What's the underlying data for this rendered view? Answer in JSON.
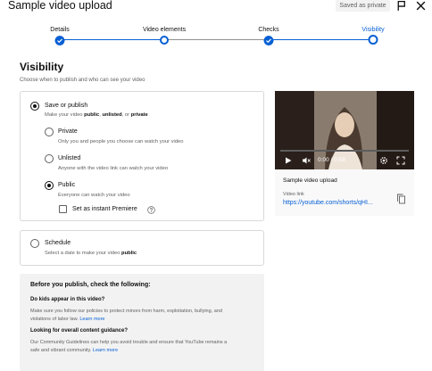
{
  "header": {
    "title": "Sample video upload",
    "saved_badge": "Saved as private",
    "icons": [
      "flag-icon",
      "close-icon"
    ]
  },
  "stepper": {
    "steps": [
      {
        "label": "Details",
        "state": "done"
      },
      {
        "label": "Video elements",
        "state": "current"
      },
      {
        "label": "Checks",
        "state": "done"
      },
      {
        "label": "Visibility",
        "state": "active"
      }
    ]
  },
  "visibility": {
    "title": "Visibility",
    "subtitle": "Choose when to publish and who can see your video",
    "save_or_publish": {
      "label": "Save or publish",
      "desc_pre": "Make your video ",
      "desc_b1": "public",
      "desc_mid1": ", ",
      "desc_b2": "unlisted",
      "desc_mid2": ", or ",
      "desc_b3": "private",
      "checked": true
    },
    "options": [
      {
        "label": "Private",
        "desc": "Only you and people you choose can watch your video",
        "checked": false
      },
      {
        "label": "Unlisted",
        "desc": "Anyone with the video link can watch your video",
        "checked": false
      },
      {
        "label": "Public",
        "desc": "Everyone can watch your video",
        "checked": true
      }
    ],
    "premiere_label": "Set as instant Premiere",
    "premiere_checked": false
  },
  "schedule": {
    "label": "Schedule",
    "desc_pre": "Select a date to make your video ",
    "desc_b": "public",
    "checked": false
  },
  "checklist": {
    "title": "Before you publish, check the following:",
    "q1": "Do kids appear in this video?",
    "p1": "Make sure you follow our policies to protect minors from harm, exploitation, bullying, and violations of labor law.",
    "p1_link": "Learn more",
    "q2": "Looking for overall content guidance?",
    "p2": "Our Community Guidelines can help you avoid trouble and ensure that YouTube remains a safe and vibrant community.",
    "p2_link": "Learn more"
  },
  "preview": {
    "time": "0:00 / 0:59",
    "title": "Sample video upload",
    "link_label": "Video link",
    "link": "https://youtube.com/shorts/qHI..."
  },
  "colors": {
    "accent": "#065fd4",
    "muted_text": "#606060",
    "panel_bg": "#f2f2f2"
  }
}
